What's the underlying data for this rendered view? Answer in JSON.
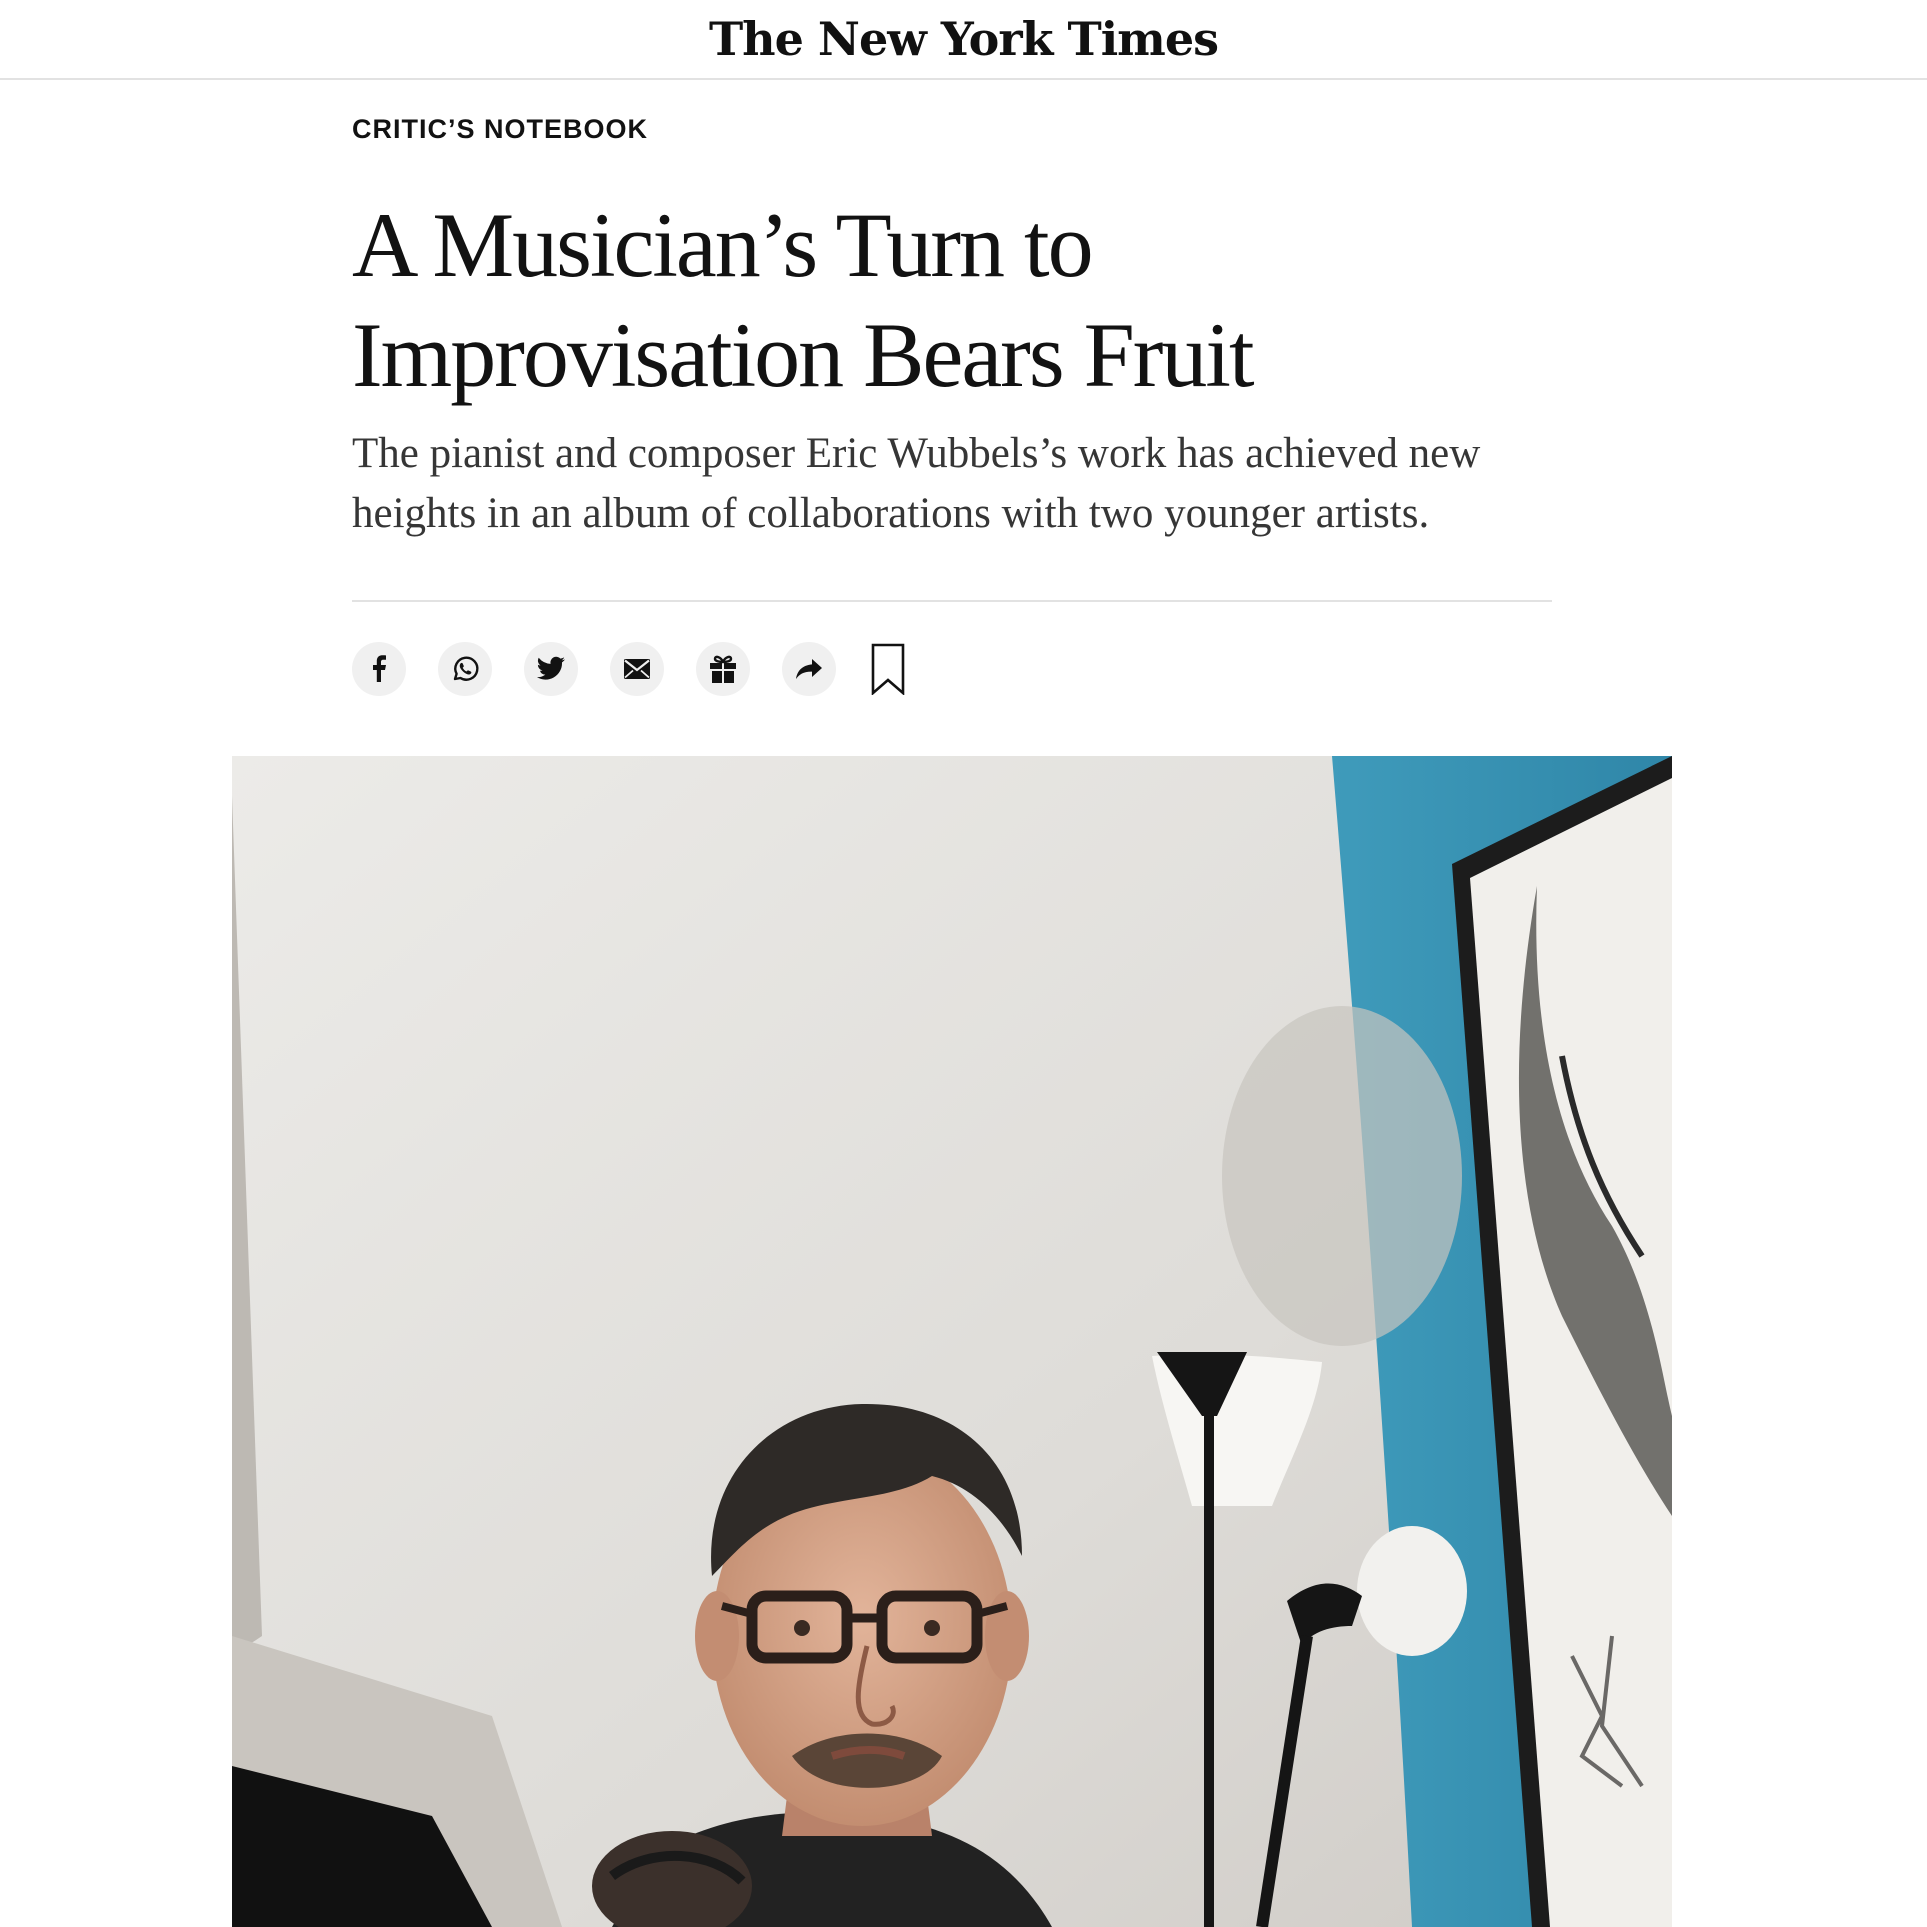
{
  "masthead": {
    "logo_text": "The New York Times"
  },
  "article": {
    "kicker": "CRITIC’S NOTEBOOK",
    "headline": "A Musician’s Turn to Improvisation Bears Fruit",
    "summary": "The pianist and composer Eric Wubbels’s work has achieved new heights in an album of collaborations with two younger artists."
  },
  "share_bar": {
    "items": [
      {
        "icon": "facebook-icon"
      },
      {
        "icon": "whatsapp-icon"
      },
      {
        "icon": "twitter-icon"
      },
      {
        "icon": "email-icon"
      },
      {
        "icon": "gift-icon"
      },
      {
        "icon": "share-arrow-icon"
      },
      {
        "icon": "bookmark-icon"
      }
    ]
  },
  "colors": {
    "text": "#121212",
    "summary_text": "#363636",
    "divider": "#e2e2e2",
    "button_bg": "#f0f0f0",
    "wall_blue": "#3a93b3"
  }
}
